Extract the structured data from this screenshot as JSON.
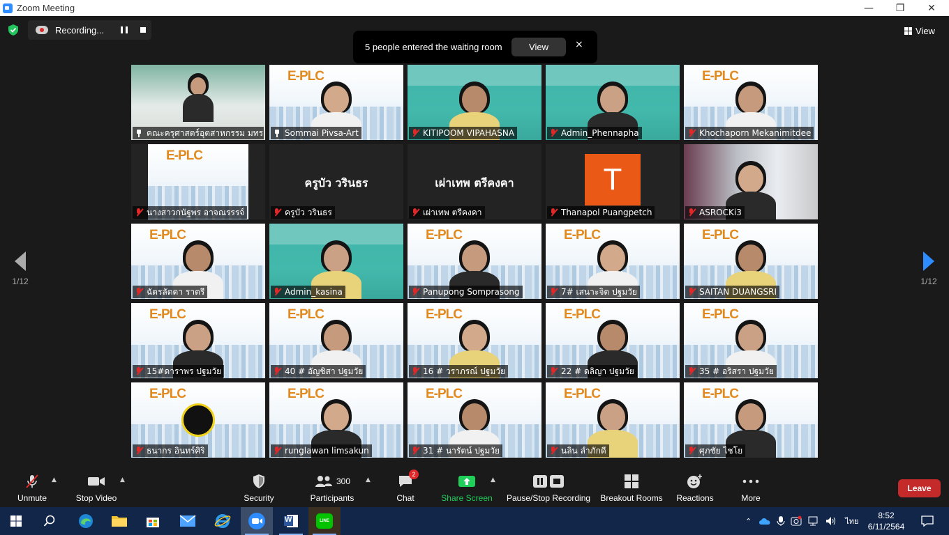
{
  "window": {
    "title": "Zoom Meeting"
  },
  "recording": {
    "label": "Recording..."
  },
  "waiting_room": {
    "message": "5 people entered the waiting room",
    "view_label": "View",
    "close": "×"
  },
  "view_toggle": {
    "label": "View"
  },
  "pagination": {
    "left": "1/12",
    "right": "1/12"
  },
  "tiles": [
    {
      "name": "คณะครุศาสตร์อุตสาหกรรม มทร...",
      "mic": "pin",
      "bg": "room",
      "center": ""
    },
    {
      "name": "Sommai Pivsa-Art",
      "mic": "pin",
      "bg": "eplc",
      "center": ""
    },
    {
      "name": "KITIPOOM VIPAHASNA",
      "mic": "muted",
      "bg": "teal",
      "center": ""
    },
    {
      "name": "Admin_Phennapha",
      "mic": "muted",
      "bg": "teal",
      "center": ""
    },
    {
      "name": "Khochaporn Mekanimitdee",
      "mic": "muted",
      "bg": "eplc",
      "center": ""
    },
    {
      "name": "นางสาวกนัฐพร อาจณรรรจ์",
      "mic": "muted",
      "bg": "eplc-small",
      "center": ""
    },
    {
      "name": "ครูบัว วรินธร",
      "mic": "muted",
      "bg": "dark",
      "center": "ครูบัว วรินธร"
    },
    {
      "name": "เผ่าเทพ  ตรีคงคา",
      "mic": "muted",
      "bg": "dark",
      "center": "เผ่าเทพ  ตรีคงคา"
    },
    {
      "name": "Thanapol Puangpetch",
      "mic": "muted",
      "bg": "dark",
      "center": "",
      "avatar": "T"
    },
    {
      "name": "ASROCKi3",
      "mic": "muted",
      "bg": "home",
      "center": ""
    },
    {
      "name": "ฉัตรลัดดา ราตรี",
      "mic": "muted",
      "bg": "eplc",
      "center": ""
    },
    {
      "name": "Admin_kasina",
      "mic": "muted",
      "bg": "teal",
      "center": ""
    },
    {
      "name": "Panupong Somprasong",
      "mic": "muted",
      "bg": "eplc",
      "center": ""
    },
    {
      "name": "7# เสนาะจิต ปฐมวัย",
      "mic": "muted",
      "bg": "eplc",
      "center": ""
    },
    {
      "name": "SAITAN DUANGSRI",
      "mic": "muted",
      "bg": "eplc",
      "center": ""
    },
    {
      "name": "15#ดาราพร ปฐมวัย",
      "mic": "muted",
      "bg": "eplc",
      "center": ""
    },
    {
      "name": "40 # อัญชิสา ปฐมวัย",
      "mic": "muted",
      "bg": "eplc",
      "center": ""
    },
    {
      "name": "16 # วราภรณ์ ปฐมวัย",
      "mic": "muted",
      "bg": "eplc",
      "center": ""
    },
    {
      "name": "22 # ดลิญา  ปฐมวัย",
      "mic": "muted",
      "bg": "eplc",
      "center": ""
    },
    {
      "name": "35 # อริสรา ปฐมวัย",
      "mic": "muted",
      "bg": "eplc",
      "center": ""
    },
    {
      "name": "ธนากร อินทร์ศิริ",
      "mic": "muted",
      "bg": "eplc",
      "center": ""
    },
    {
      "name": "runglawan limsakun",
      "mic": "muted",
      "bg": "eplc",
      "center": ""
    },
    {
      "name": "31 # นารัตน์ ปฐมวัย",
      "mic": "muted",
      "bg": "eplc",
      "center": ""
    },
    {
      "name": "นลิน ลำภักดี",
      "mic": "muted",
      "bg": "eplc",
      "center": ""
    },
    {
      "name": "ศุภชัย ไชโย",
      "mic": "muted",
      "bg": "eplc",
      "center": ""
    }
  ],
  "toolbar": {
    "unmute": "Unmute",
    "stop_video": "Stop Video",
    "security": "Security",
    "participants": "Participants",
    "participants_count": "300",
    "chat": "Chat",
    "chat_badge": "2",
    "share_screen": "Share Screen",
    "pause_stop_recording": "Pause/Stop Recording",
    "breakout_rooms": "Breakout Rooms",
    "reactions": "Reactions",
    "more": "More",
    "leave": "Leave"
  },
  "taskbar": {
    "lang": "ไทย",
    "time": "8:52",
    "date": "6/11/2564",
    "word_letter": "W",
    "line_label": "LINE"
  },
  "colors": {
    "accent": "#2d8cff",
    "share_green": "#1fcf5a",
    "leave_red": "#c52a2a",
    "active_speaker": "#f0e24a"
  }
}
